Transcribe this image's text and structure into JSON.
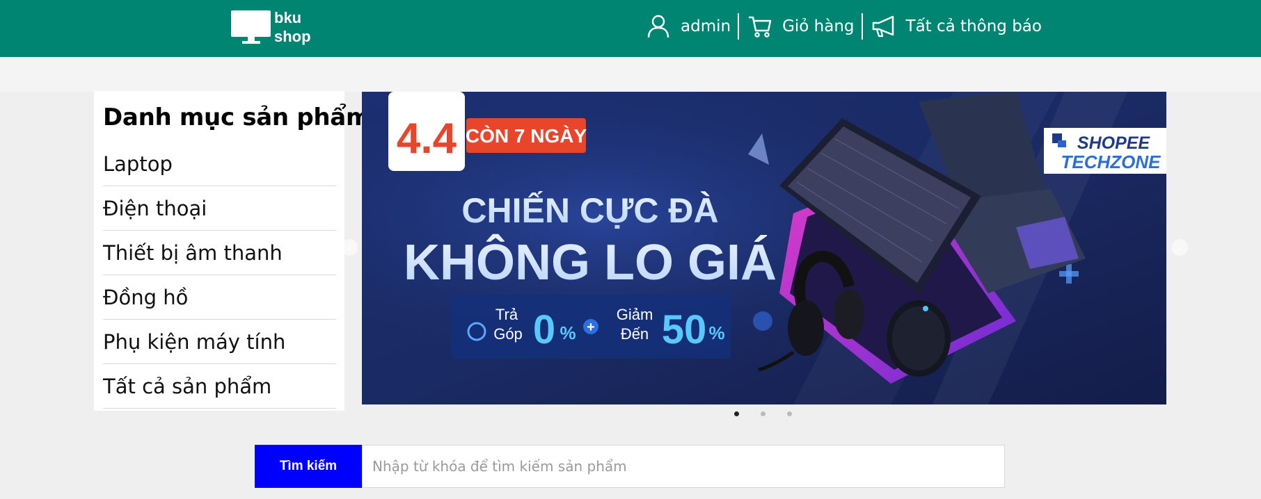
{
  "header": {
    "logo_line1": "bku",
    "logo_line2": "shop",
    "account_label": "admin",
    "cart_label": "Giỏ hàng",
    "notifications_label": "Tất cả thông báo",
    "background_color": "#008572"
  },
  "category_menu": {
    "title": "Danh mục sản phẩm",
    "items": [
      {
        "label": "Laptop"
      },
      {
        "label": "Điện thoại"
      },
      {
        "label": "Thiết bị âm thanh"
      },
      {
        "label": "Đồng hồ"
      },
      {
        "label": "Phụ kiện máy tính"
      },
      {
        "label": "Tất cả sản phẩm"
      }
    ]
  },
  "banner": {
    "badge_number": "4.4",
    "badge_days": "CÒN 7 NGÀY",
    "headline_1": "CHIẾN CỰC ĐÀ",
    "headline_2": "KHÔNG LO GIÁ",
    "offer_1_label_a": "Trả",
    "offer_1_label_b": "Góp",
    "offer_1_value": "0",
    "offer_1_unit": "%",
    "offer_2_label_a": "Giảm",
    "offer_2_label_b": "Đến",
    "offer_2_value": "50",
    "offer_2_unit": "%",
    "brand_1": "SHOPEE",
    "brand_2": "TECHZONE",
    "slide_count": 3,
    "active_slide": 1
  },
  "search": {
    "button_label": "Tìm kiếm",
    "placeholder": "Nhập từ khóa để tìm kiếm sản phẩm",
    "button_color": "#0000ff"
  }
}
